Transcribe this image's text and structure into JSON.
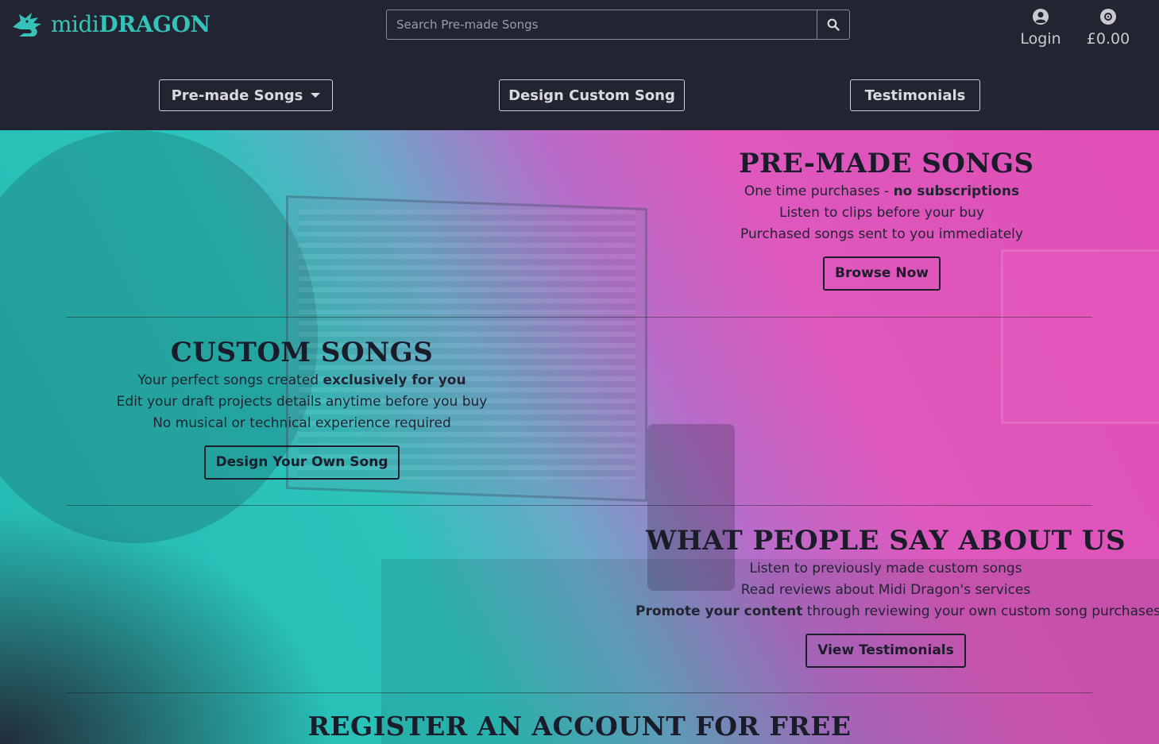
{
  "brand": {
    "name_light": "midi",
    "name_bold": "DRAGON",
    "color": "#35c3b9"
  },
  "search": {
    "placeholder": "Search Pre-made Songs",
    "icon": "search-icon"
  },
  "user": {
    "login_label": "Login",
    "login_icon": "user-circle-icon",
    "cart_label": "£0.00",
    "cart_icon": "disc-icon"
  },
  "nav": {
    "premade_label": "Pre-made Songs",
    "design_label": "Design Custom Song",
    "testimonials_label": "Testimonials"
  },
  "premade": {
    "title": "PRE-MADE SONGS",
    "line1_pre": "One time purchases - ",
    "line1_bold": "no subscriptions",
    "line2": "Listen to clips before your buy",
    "line3": "Purchased songs sent to you immediately",
    "button": "Browse Now"
  },
  "custom": {
    "title": "CUSTOM SONGS",
    "line1_pre": "Your perfect songs created ",
    "line1_bold": "exclusively for you",
    "line2": "Edit your draft projects details anytime before you buy",
    "line3": "No musical or technical experience required",
    "button": "Design Your Own Song"
  },
  "testimonials": {
    "title": "WHAT PEOPLE SAY ABOUT US",
    "line1": "Listen to previously made custom songs",
    "line2": "Read reviews about Midi Dragon's services",
    "line3_bold": "Promote your content",
    "line3_post": " through reviewing your own custom song purchases",
    "button": "View Testimonials"
  },
  "register": {
    "title": "REGISTER AN ACCOUNT FOR FREE"
  },
  "colors": {
    "header_bg": "#222432",
    "teal": "#2bc4bb",
    "pink": "#e04fb6"
  }
}
